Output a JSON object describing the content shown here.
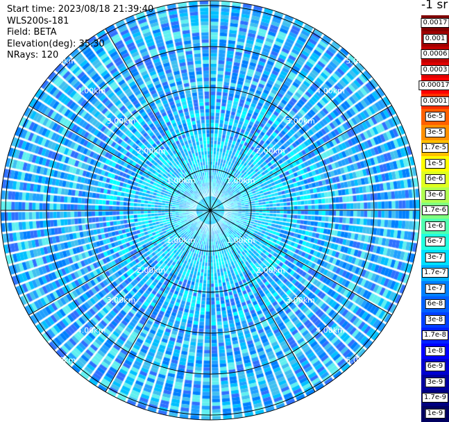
{
  "header": {
    "start_time": "Start time: 2023/08/18 21:39:40",
    "instrument": "WLS200s-181",
    "field": "Field: BETA",
    "elevation": "Elevation(deg): 35.30",
    "nrays": "NRays: 120"
  },
  "colorbar": {
    "unit": "-1 sr",
    "labels": [
      "0.0017",
      "0.001",
      "0.0006",
      "0.0003",
      "0.00017",
      "0.0001",
      "6e-5",
      "3e-5",
      "1.7e-5",
      "1e-5",
      "6e-6",
      "3e-6",
      "1.7e-6",
      "1e-6",
      "6e-7",
      "3e-7",
      "1.7e-7",
      "1e-7",
      "6e-8",
      "3e-8",
      "1.7e-8",
      "1e-8",
      "6e-9",
      "3e-9",
      "1.7e-9",
      "1e-9"
    ],
    "colors": [
      "#800000",
      "#a00000",
      "#c00000",
      "#e00000",
      "#ff0000",
      "#ff3000",
      "#ff6000",
      "#ff9000",
      "#ffc000",
      "#ffff00",
      "#e0ff20",
      "#b0ff50",
      "#80ff80",
      "#50ffb0",
      "#20ffe0",
      "#00e0ff",
      "#00b0ff",
      "#0080ff",
      "#0060ff",
      "#0040ff",
      "#0020ff",
      "#0000ff",
      "#0000d0",
      "#0000a0",
      "#000080",
      "#000060"
    ]
  },
  "ppi": {
    "ring_labels": [
      "1.00km",
      "2.00km",
      "3.00km",
      "4.00km",
      "5.00km"
    ],
    "palette": [
      "#00ffff",
      "#20e0ff",
      "#00c0ff",
      "#20a0ff",
      "#0080ff",
      "#3070ff",
      "#40c0f0",
      "#60f0f0"
    ]
  }
}
